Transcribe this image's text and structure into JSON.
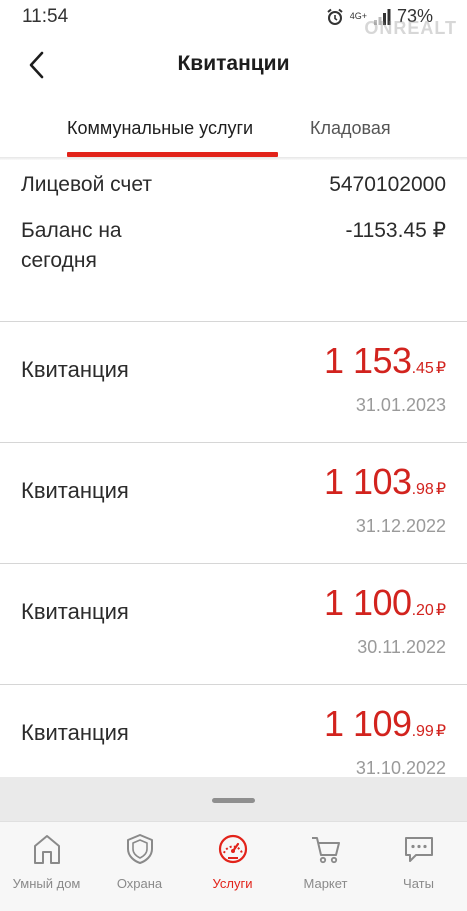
{
  "status_bar": {
    "time": "11:54",
    "network": "4G+",
    "battery": "73%",
    "watermark": "ONREALT"
  },
  "header": {
    "title": "Квитанции",
    "back_icon": "chevron-left-icon"
  },
  "tabs": [
    {
      "label": "Коммунальные услуги",
      "active": true
    },
    {
      "label": "Кладовая",
      "active": false
    }
  ],
  "account": {
    "account_label": "Лицевой счет",
    "account_value": "5470102000",
    "balance_label_line1": "Баланс на",
    "balance_label_line2": "сегодня",
    "balance_value": "-1153.45 ₽"
  },
  "receipts": [
    {
      "label": "Квитанция",
      "amount_int": "1 153",
      "amount_frac": ".45",
      "currency": "₽",
      "date": "31.01.2023"
    },
    {
      "label": "Квитанция",
      "amount_int": "1 103",
      "amount_frac": ".98",
      "currency": "₽",
      "date": "31.12.2022"
    },
    {
      "label": "Квитанция",
      "amount_int": "1 100",
      "amount_frac": ".20",
      "currency": "₽",
      "date": "30.11.2022"
    },
    {
      "label": "Квитанция",
      "amount_int": "1 109",
      "amount_frac": ".99",
      "currency": "₽",
      "date": "31.10.2022"
    }
  ],
  "bottom_nav": [
    {
      "label": "Умный дом",
      "icon": "home-icon",
      "active": false
    },
    {
      "label": "Охрана",
      "icon": "shield-icon",
      "active": false
    },
    {
      "label": "Услуги",
      "icon": "speedometer-icon",
      "active": true
    },
    {
      "label": "Маркет",
      "icon": "cart-icon",
      "active": false
    },
    {
      "label": "Чаты",
      "icon": "chat-icon",
      "active": false
    }
  ],
  "colors": {
    "accent": "#e2231a",
    "amount": "#d2231e",
    "muted": "#9a9a9a"
  }
}
